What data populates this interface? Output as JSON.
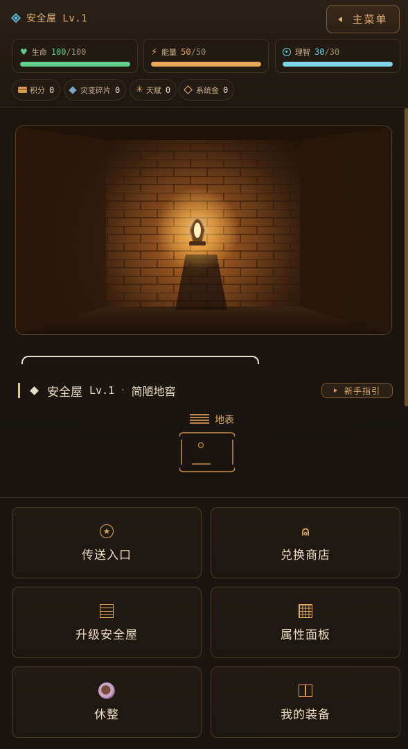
{
  "header": {
    "title": "安全屋 Lv.1",
    "menu_label": "主菜单"
  },
  "stats": [
    {
      "label": "生命",
      "current": "100",
      "max": "/100",
      "value_color": "#5fcf8a",
      "bar_color": "#5fcf8a",
      "fill_fraction": 1.0,
      "icon": "heart-icon"
    },
    {
      "label": "能量",
      "current": "50",
      "max": "/50",
      "value_color": "#e8a65a",
      "bar_color": "#e8a65a",
      "fill_fraction": 1.0,
      "icon": "bolt-icon"
    },
    {
      "label": "理智",
      "current": "30",
      "max": "/30",
      "value_color": "#6cd0e6",
      "bar_color": "#7fd6ea",
      "fill_fraction": 1.0,
      "icon": "target-icon"
    }
  ],
  "resources": [
    {
      "label": "积分",
      "value": "0",
      "icon": "chest-icon"
    },
    {
      "label": "灾变碎片",
      "value": "0",
      "icon": "shard-icon"
    },
    {
      "label": "天赋",
      "value": "0",
      "icon": "spark-icon"
    },
    {
      "label": "系统金",
      "value": "0",
      "icon": "gold-icon"
    }
  ],
  "location": {
    "name": "安全屋",
    "level": "Lv.1",
    "separator": "·",
    "subtitle": "简陋地窖",
    "guide_label": "新手指引",
    "floor_label": "地表"
  },
  "actions": [
    {
      "label": "传送入口",
      "icon": "star-circle-icon"
    },
    {
      "label": "兑换商店",
      "icon": "shop-icon"
    },
    {
      "label": "升级安全屋",
      "icon": "list-icon"
    },
    {
      "label": "属性面板",
      "icon": "grid-icon"
    },
    {
      "label": "休整",
      "icon": "cup-icon"
    },
    {
      "label": "我的装备",
      "icon": "book-icon"
    }
  ]
}
